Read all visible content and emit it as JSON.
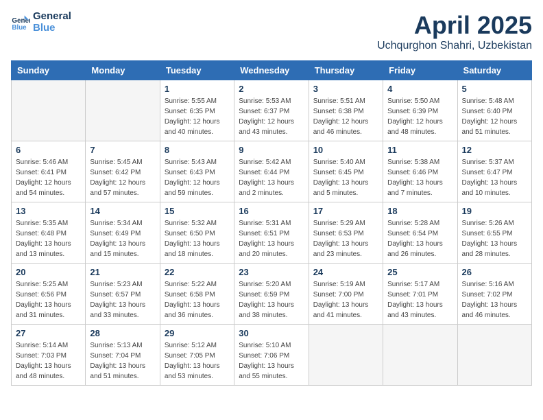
{
  "header": {
    "logo_line1": "General",
    "logo_line2": "Blue",
    "title": "April 2025",
    "subtitle": "Uchqurghon Shahri, Uzbekistan"
  },
  "weekdays": [
    "Sunday",
    "Monday",
    "Tuesday",
    "Wednesday",
    "Thursday",
    "Friday",
    "Saturday"
  ],
  "weeks": [
    [
      {
        "day": "",
        "info": ""
      },
      {
        "day": "",
        "info": ""
      },
      {
        "day": "1",
        "info": "Sunrise: 5:55 AM\nSunset: 6:35 PM\nDaylight: 12 hours and 40 minutes."
      },
      {
        "day": "2",
        "info": "Sunrise: 5:53 AM\nSunset: 6:37 PM\nDaylight: 12 hours and 43 minutes."
      },
      {
        "day": "3",
        "info": "Sunrise: 5:51 AM\nSunset: 6:38 PM\nDaylight: 12 hours and 46 minutes."
      },
      {
        "day": "4",
        "info": "Sunrise: 5:50 AM\nSunset: 6:39 PM\nDaylight: 12 hours and 48 minutes."
      },
      {
        "day": "5",
        "info": "Sunrise: 5:48 AM\nSunset: 6:40 PM\nDaylight: 12 hours and 51 minutes."
      }
    ],
    [
      {
        "day": "6",
        "info": "Sunrise: 5:46 AM\nSunset: 6:41 PM\nDaylight: 12 hours and 54 minutes."
      },
      {
        "day": "7",
        "info": "Sunrise: 5:45 AM\nSunset: 6:42 PM\nDaylight: 12 hours and 57 minutes."
      },
      {
        "day": "8",
        "info": "Sunrise: 5:43 AM\nSunset: 6:43 PM\nDaylight: 12 hours and 59 minutes."
      },
      {
        "day": "9",
        "info": "Sunrise: 5:42 AM\nSunset: 6:44 PM\nDaylight: 13 hours and 2 minutes."
      },
      {
        "day": "10",
        "info": "Sunrise: 5:40 AM\nSunset: 6:45 PM\nDaylight: 13 hours and 5 minutes."
      },
      {
        "day": "11",
        "info": "Sunrise: 5:38 AM\nSunset: 6:46 PM\nDaylight: 13 hours and 7 minutes."
      },
      {
        "day": "12",
        "info": "Sunrise: 5:37 AM\nSunset: 6:47 PM\nDaylight: 13 hours and 10 minutes."
      }
    ],
    [
      {
        "day": "13",
        "info": "Sunrise: 5:35 AM\nSunset: 6:48 PM\nDaylight: 13 hours and 13 minutes."
      },
      {
        "day": "14",
        "info": "Sunrise: 5:34 AM\nSunset: 6:49 PM\nDaylight: 13 hours and 15 minutes."
      },
      {
        "day": "15",
        "info": "Sunrise: 5:32 AM\nSunset: 6:50 PM\nDaylight: 13 hours and 18 minutes."
      },
      {
        "day": "16",
        "info": "Sunrise: 5:31 AM\nSunset: 6:51 PM\nDaylight: 13 hours and 20 minutes."
      },
      {
        "day": "17",
        "info": "Sunrise: 5:29 AM\nSunset: 6:53 PM\nDaylight: 13 hours and 23 minutes."
      },
      {
        "day": "18",
        "info": "Sunrise: 5:28 AM\nSunset: 6:54 PM\nDaylight: 13 hours and 26 minutes."
      },
      {
        "day": "19",
        "info": "Sunrise: 5:26 AM\nSunset: 6:55 PM\nDaylight: 13 hours and 28 minutes."
      }
    ],
    [
      {
        "day": "20",
        "info": "Sunrise: 5:25 AM\nSunset: 6:56 PM\nDaylight: 13 hours and 31 minutes."
      },
      {
        "day": "21",
        "info": "Sunrise: 5:23 AM\nSunset: 6:57 PM\nDaylight: 13 hours and 33 minutes."
      },
      {
        "day": "22",
        "info": "Sunrise: 5:22 AM\nSunset: 6:58 PM\nDaylight: 13 hours and 36 minutes."
      },
      {
        "day": "23",
        "info": "Sunrise: 5:20 AM\nSunset: 6:59 PM\nDaylight: 13 hours and 38 minutes."
      },
      {
        "day": "24",
        "info": "Sunrise: 5:19 AM\nSunset: 7:00 PM\nDaylight: 13 hours and 41 minutes."
      },
      {
        "day": "25",
        "info": "Sunrise: 5:17 AM\nSunset: 7:01 PM\nDaylight: 13 hours and 43 minutes."
      },
      {
        "day": "26",
        "info": "Sunrise: 5:16 AM\nSunset: 7:02 PM\nDaylight: 13 hours and 46 minutes."
      }
    ],
    [
      {
        "day": "27",
        "info": "Sunrise: 5:14 AM\nSunset: 7:03 PM\nDaylight: 13 hours and 48 minutes."
      },
      {
        "day": "28",
        "info": "Sunrise: 5:13 AM\nSunset: 7:04 PM\nDaylight: 13 hours and 51 minutes."
      },
      {
        "day": "29",
        "info": "Sunrise: 5:12 AM\nSunset: 7:05 PM\nDaylight: 13 hours and 53 minutes."
      },
      {
        "day": "30",
        "info": "Sunrise: 5:10 AM\nSunset: 7:06 PM\nDaylight: 13 hours and 55 minutes."
      },
      {
        "day": "",
        "info": ""
      },
      {
        "day": "",
        "info": ""
      },
      {
        "day": "",
        "info": ""
      }
    ]
  ]
}
